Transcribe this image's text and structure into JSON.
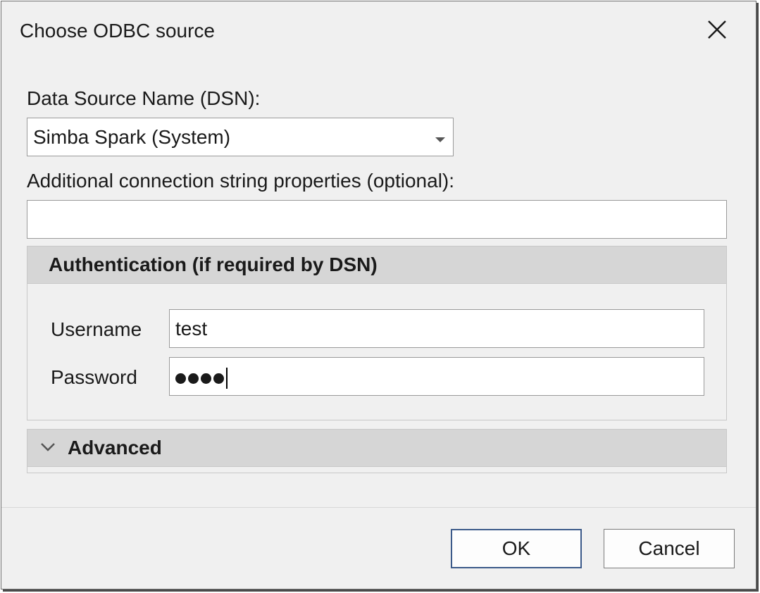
{
  "dialog": {
    "title": "Choose ODBC source"
  },
  "dsn": {
    "label": "Data Source Name (DSN):",
    "selected": "Simba Spark (System)"
  },
  "connection_string": {
    "label": "Additional connection string properties (optional):",
    "value": ""
  },
  "authentication": {
    "title": "Authentication (if required by DSN)",
    "username_label": "Username",
    "username_value": "test",
    "password_label": "Password",
    "password_mask_count": 4
  },
  "advanced": {
    "title": "Advanced",
    "expanded": false
  },
  "buttons": {
    "ok_label": "OK",
    "cancel_label": "Cancel"
  },
  "icons": {
    "close": "close-icon",
    "dropdown": "chevron-down-icon",
    "expand": "chevron-down-icon"
  },
  "colors": {
    "dialog_bg": "#f0f0f0",
    "section_header_bg": "#d6d6d6",
    "default_button_border": "#3c5a8a"
  }
}
